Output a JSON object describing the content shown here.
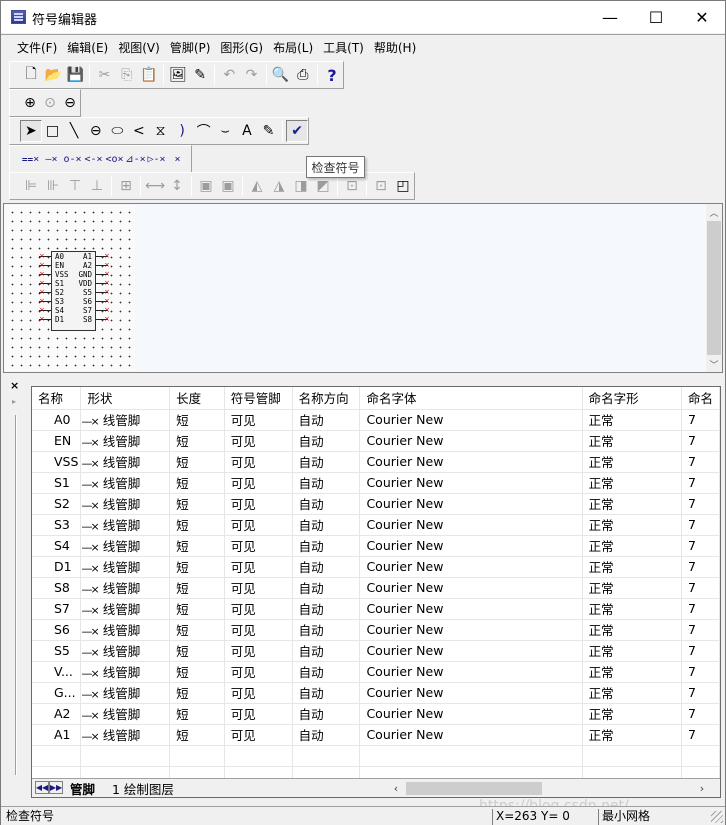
{
  "window": {
    "title": "符号编辑器",
    "controls": {
      "minimize": "—",
      "maximize": "☐",
      "close": "✕"
    }
  },
  "menu": [
    "文件(F)",
    "编辑(E)",
    "视图(V)",
    "管脚(P)",
    "图形(G)",
    "布局(L)",
    "工具(T)",
    "帮助(H)"
  ],
  "toolbars": {
    "standard": [
      {
        "name": "new-file-icon",
        "glyph": "🗋",
        "enabled": true
      },
      {
        "name": "open-folder-icon",
        "glyph": "📂",
        "enabled": true
      },
      {
        "name": "save-icon",
        "glyph": "💾",
        "enabled": true
      },
      {
        "sep": true
      },
      {
        "name": "cut-icon",
        "glyph": "✂",
        "enabled": false
      },
      {
        "name": "copy-icon",
        "glyph": "⎘",
        "enabled": false
      },
      {
        "name": "paste-icon",
        "glyph": "📋",
        "enabled": true
      },
      {
        "sep": true
      },
      {
        "name": "image-icon",
        "glyph": "🖼",
        "enabled": true
      },
      {
        "name": "edit-properties-icon",
        "glyph": "✎",
        "enabled": true
      },
      {
        "sep": true
      },
      {
        "name": "undo-icon",
        "glyph": "↶",
        "enabled": false
      },
      {
        "name": "redo-icon",
        "glyph": "↷",
        "enabled": false
      },
      {
        "sep": true
      },
      {
        "name": "print-preview-icon",
        "glyph": "🔍",
        "enabled": true
      },
      {
        "name": "print-icon",
        "glyph": "⎙",
        "enabled": true
      },
      {
        "sep": true
      },
      {
        "name": "help-icon",
        "glyph": "?",
        "enabled": true
      }
    ],
    "zoom": [
      {
        "name": "zoom-in-icon",
        "glyph": "⊕",
        "enabled": true
      },
      {
        "name": "zoom-fit-icon",
        "glyph": "⊙",
        "enabled": false
      },
      {
        "name": "zoom-out-icon",
        "glyph": "⊖",
        "enabled": true
      }
    ],
    "draw": [
      {
        "name": "select-pointer-icon",
        "glyph": "➤",
        "enabled": true,
        "pressed": true
      },
      {
        "name": "rectangle-icon",
        "glyph": "□",
        "enabled": true
      },
      {
        "name": "line-icon",
        "glyph": "╲",
        "enabled": true
      },
      {
        "name": "circle-icon",
        "glyph": "⊖",
        "enabled": true
      },
      {
        "name": "ellipse-icon",
        "glyph": "⬭",
        "enabled": true
      },
      {
        "name": "polyline-icon",
        "glyph": "<",
        "enabled": true
      },
      {
        "name": "polygon-icon",
        "glyph": "⧖",
        "enabled": true
      },
      {
        "name": "arc-icon",
        "glyph": ")",
        "enabled": true
      },
      {
        "name": "curve-icon",
        "glyph": "⌒",
        "enabled": true
      },
      {
        "name": "bezier-icon",
        "glyph": "⌣",
        "enabled": true
      },
      {
        "name": "text-icon",
        "glyph": "A",
        "enabled": true
      },
      {
        "name": "graphic-properties-icon",
        "glyph": "✎",
        "enabled": true
      },
      {
        "sep": true
      },
      {
        "name": "check-symbol-icon",
        "glyph": "✔",
        "enabled": true,
        "pressed": true
      }
    ],
    "pins": [
      {
        "name": "pin-array-icon",
        "glyph": "⩵×"
      },
      {
        "name": "pin-line-icon",
        "glyph": "—×"
      },
      {
        "name": "pin-dot-icon",
        "glyph": "o-×"
      },
      {
        "name": "pin-clock-icon",
        "glyph": "<-×"
      },
      {
        "name": "pin-dot-clock-icon",
        "glyph": "<o×"
      },
      {
        "name": "pin-input-icon",
        "glyph": "⊿-×"
      },
      {
        "name": "pin-output-icon",
        "glyph": "▷-×"
      },
      {
        "name": "pin-none-icon",
        "glyph": "×"
      }
    ],
    "layout": [
      {
        "name": "align-left-icon",
        "glyph": "⊫"
      },
      {
        "name": "align-right-icon",
        "glyph": "⊪"
      },
      {
        "name": "align-top-icon",
        "glyph": "⊤"
      },
      {
        "name": "align-bottom-icon",
        "glyph": "⊥"
      },
      {
        "sep": true
      },
      {
        "name": "align-center-icon",
        "glyph": "⊞"
      },
      {
        "sep": true
      },
      {
        "name": "space-horizontal-icon",
        "glyph": "⟷"
      },
      {
        "name": "space-vertical-icon",
        "glyph": "↕"
      },
      {
        "sep": true
      },
      {
        "name": "bring-front-icon",
        "glyph": "▣"
      },
      {
        "name": "send-back-icon",
        "glyph": "▣"
      },
      {
        "sep": true
      },
      {
        "name": "rotate-left-icon",
        "glyph": "◭"
      },
      {
        "name": "rotate-right-icon",
        "glyph": "◮"
      },
      {
        "name": "flip-horizontal-icon",
        "glyph": "◨"
      },
      {
        "name": "flip-vertical-icon",
        "glyph": "◩"
      },
      {
        "sep": true
      },
      {
        "name": "group-icon",
        "glyph": "⊡"
      },
      {
        "sep": true
      },
      {
        "name": "ungroup-icon",
        "glyph": "⊡"
      },
      {
        "name": "resize-icon",
        "glyph": "◰",
        "enabled": true
      }
    ]
  },
  "tooltip": "检查符号",
  "symbol": {
    "left_pins": [
      "A0",
      "EN",
      "VSS",
      "S1",
      "S2",
      "S3",
      "S4",
      "D1"
    ],
    "right_pins": [
      "A1",
      "A2",
      "GND",
      "VDD",
      "S5",
      "S6",
      "S7",
      "S8"
    ]
  },
  "table": {
    "columns": [
      "名称",
      "形状",
      "长度",
      "符号管脚",
      "名称方向",
      "命名字体",
      "命名字形",
      "命名"
    ],
    "rows": [
      {
        "name": "A0",
        "shape": "线管脚",
        "length": "短",
        "visible": "可见",
        "direction": "自动",
        "font": "Courier New",
        "style": "正常",
        "size": "7"
      },
      {
        "name": "EN",
        "shape": "线管脚",
        "length": "短",
        "visible": "可见",
        "direction": "自动",
        "font": "Courier New",
        "style": "正常",
        "size": "7"
      },
      {
        "name": "VSS",
        "shape": "线管脚",
        "length": "短",
        "visible": "可见",
        "direction": "自动",
        "font": "Courier New",
        "style": "正常",
        "size": "7"
      },
      {
        "name": "S1",
        "shape": "线管脚",
        "length": "短",
        "visible": "可见",
        "direction": "自动",
        "font": "Courier New",
        "style": "正常",
        "size": "7"
      },
      {
        "name": "S2",
        "shape": "线管脚",
        "length": "短",
        "visible": "可见",
        "direction": "自动",
        "font": "Courier New",
        "style": "正常",
        "size": "7"
      },
      {
        "name": "S3",
        "shape": "线管脚",
        "length": "短",
        "visible": "可见",
        "direction": "自动",
        "font": "Courier New",
        "style": "正常",
        "size": "7"
      },
      {
        "name": "S4",
        "shape": "线管脚",
        "length": "短",
        "visible": "可见",
        "direction": "自动",
        "font": "Courier New",
        "style": "正常",
        "size": "7"
      },
      {
        "name": "D1",
        "shape": "线管脚",
        "length": "短",
        "visible": "可见",
        "direction": "自动",
        "font": "Courier New",
        "style": "正常",
        "size": "7"
      },
      {
        "name": "S8",
        "shape": "线管脚",
        "length": "短",
        "visible": "可见",
        "direction": "自动",
        "font": "Courier New",
        "style": "正常",
        "size": "7"
      },
      {
        "name": "S7",
        "shape": "线管脚",
        "length": "短",
        "visible": "可见",
        "direction": "自动",
        "font": "Courier New",
        "style": "正常",
        "size": "7"
      },
      {
        "name": "S6",
        "shape": "线管脚",
        "length": "短",
        "visible": "可见",
        "direction": "自动",
        "font": "Courier New",
        "style": "正常",
        "size": "7"
      },
      {
        "name": "S5",
        "shape": "线管脚",
        "length": "短",
        "visible": "可见",
        "direction": "自动",
        "font": "Courier New",
        "style": "正常",
        "size": "7"
      },
      {
        "name": "V...",
        "shape": "线管脚",
        "length": "短",
        "visible": "可见",
        "direction": "自动",
        "font": "Courier New",
        "style": "正常",
        "size": "7"
      },
      {
        "name": "G...",
        "shape": "线管脚",
        "length": "短",
        "visible": "可见",
        "direction": "自动",
        "font": "Courier New",
        "style": "正常",
        "size": "7"
      },
      {
        "name": "A2",
        "shape": "线管脚",
        "length": "短",
        "visible": "可见",
        "direction": "自动",
        "font": "Courier New",
        "style": "正常",
        "size": "7"
      },
      {
        "name": "A1",
        "shape": "线管脚",
        "length": "短",
        "visible": "可见",
        "direction": "自动",
        "font": "Courier New",
        "style": "正常",
        "size": "7"
      }
    ],
    "empty_rows": 2
  },
  "sheet_tabs": [
    {
      "label": "管脚",
      "active": true
    },
    {
      "label": "1  绘制图层",
      "active": false
    }
  ],
  "panel": {
    "close_glyph": "×",
    "arrow_glyph": "▸"
  },
  "status": {
    "message": "检查符号",
    "coords": "X=263 Y=  0",
    "grid": "最小网格"
  },
  "colors": {
    "pin_marker": "#c00000",
    "canvas_bg": "#f5f8fc",
    "pin_icon": "#1a1a80"
  }
}
